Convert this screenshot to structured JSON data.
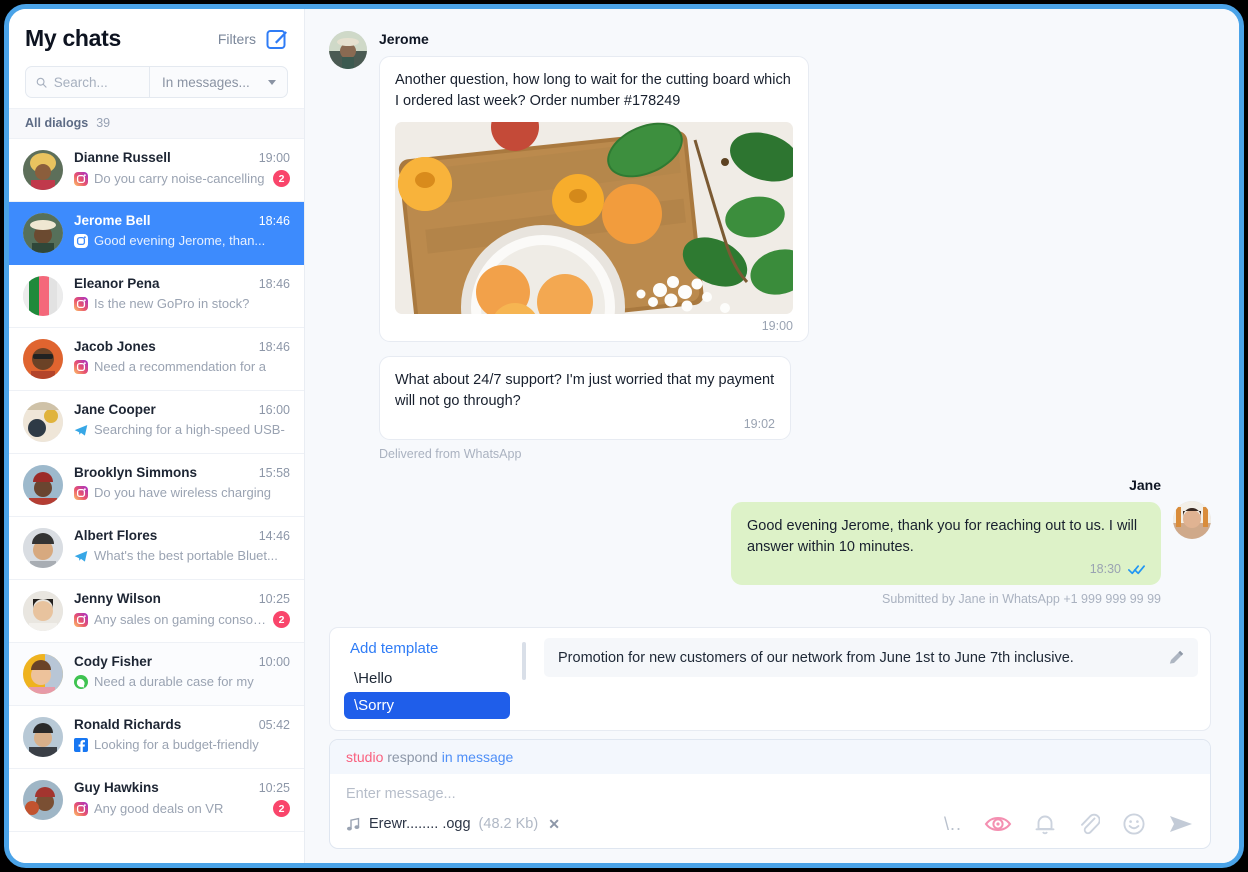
{
  "sidebar": {
    "title": "My chats",
    "filters_label": "Filters",
    "compose_icon": "compose-pencil-icon",
    "search": {
      "placeholder": "Search...",
      "value": "",
      "icon": "search-icon"
    },
    "scope": {
      "value": "In messages...",
      "icon": "chevron-down-icon"
    },
    "all_dialogs": {
      "label": "All dialogs",
      "count": "39"
    },
    "chats": [
      {
        "name": "Dianne Russell",
        "time": "19:00",
        "preview": "Do you carry noise-cancelling",
        "source": "instagram",
        "badge": "2",
        "selected": false
      },
      {
        "name": "Jerome Bell",
        "time": "18:46",
        "preview": "Good evening Jerome, than...",
        "source": "instagram",
        "badge": "",
        "selected": true
      },
      {
        "name": "Eleanor Pena",
        "time": "18:46",
        "preview": "Is the new GoPro in stock?",
        "source": "instagram",
        "badge": "",
        "selected": false
      },
      {
        "name": "Jacob Jones",
        "time": "18:46",
        "preview": "Need a recommendation for a",
        "source": "instagram",
        "badge": "",
        "selected": false
      },
      {
        "name": "Jane Cooper",
        "time": "16:00",
        "preview": "Searching for a high-speed USB-",
        "source": "telegram",
        "badge": "",
        "selected": false
      },
      {
        "name": "Brooklyn Simmons",
        "time": "15:58",
        "preview": "Do you have wireless charging",
        "source": "instagram",
        "badge": "",
        "selected": false
      },
      {
        "name": "Albert Flores",
        "time": "14:46",
        "preview": "What's the best portable Bluet...",
        "source": "telegram",
        "badge": "",
        "selected": false
      },
      {
        "name": "Jenny Wilson",
        "time": "10:25",
        "preview": "Any sales on gaming consoles",
        "source": "instagram",
        "badge": "2",
        "selected": false
      },
      {
        "name": "Cody Fisher",
        "time": "10:00",
        "preview": "Need a durable case for my",
        "source": "whatsapp",
        "badge": "",
        "selected": false
      },
      {
        "name": "Ronald Richards",
        "time": "05:42",
        "preview": "Looking for a budget-friendly",
        "source": "facebook",
        "badge": "",
        "selected": false
      },
      {
        "name": "Guy Hawkins",
        "time": "10:25",
        "preview": "Any good deals on VR",
        "source": "instagram",
        "badge": "2",
        "selected": false
      }
    ]
  },
  "conversation": {
    "incoming_sender": "Jerome",
    "outgoing_sender": "Jane",
    "messages": [
      {
        "text": "Another question, how long to wait for the cutting board which I ordered last week?  Order number #178249",
        "time": "19:00",
        "has_image": true,
        "image_alt": "apricots-on-cutting-board-photo"
      },
      {
        "text": "What about 24/7 support? I'm just worried that my payment will not go through?",
        "time": "19:02",
        "has_image": false
      }
    ],
    "incoming_status": "Delivered from WhatsApp",
    "outgoing": {
      "text": "Good evening Jerome, thank you for reaching out to us. I will answer within 10 minutes.",
      "time": "18:30",
      "read_icon": "double-check-icon"
    },
    "outgoing_status": "Submitted by Jane in WhatsApp +1 999 999 99 99"
  },
  "templates": {
    "add_label": "Add template",
    "items": [
      {
        "label": "\\Hello",
        "active": false
      },
      {
        "label": "\\Sorry",
        "active": true
      }
    ],
    "preview_text": "Promotion for new customers of our network from June 1st to June 7th inclusive.",
    "edit_icon": "pencil-icon"
  },
  "composer": {
    "tag_account": "studio",
    "tag_action": "respond",
    "tag_channel": "in message",
    "input_placeholder": "Enter message...",
    "attachment": {
      "icon": "music-note-icon",
      "name": "Erewr........ .ogg",
      "size": "(48.2 Kb)",
      "remove": "✕"
    },
    "tools": [
      {
        "name": "template-shortcut",
        "label": "\\..",
        "color": "#b9c1cd"
      },
      {
        "name": "eye-icon",
        "label": "",
        "color": "#f48fb1"
      },
      {
        "name": "bell-icon",
        "label": "",
        "color": "#ccd3de"
      },
      {
        "name": "paperclip-icon",
        "label": "",
        "color": "#ccd3de"
      },
      {
        "name": "emoji-icon",
        "label": "",
        "color": "#ccd3de"
      },
      {
        "name": "send-icon",
        "label": "",
        "color": "#c3cbd7"
      }
    ]
  },
  "colors": {
    "accent_blue": "#3d8bfd",
    "template_blue": "#1f5eea",
    "badge_red": "#f9456b",
    "outgoing_bubble": "#ddf2c8",
    "eye_pink": "#f48fb1",
    "frame_blue": "#4aa3e8"
  }
}
